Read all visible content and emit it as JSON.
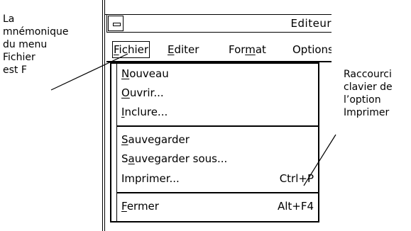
{
  "callouts": {
    "left": "La\nmnémonique\ndu menu\nFichier\nest F",
    "right": "Raccourci\nclavier de\nl’option\nImprimer"
  },
  "window": {
    "title": "Editeur"
  },
  "menubar": [
    {
      "pre": "",
      "mnemonic": "F",
      "post": "ichier"
    },
    {
      "pre": "",
      "mnemonic": "E",
      "post": "diter"
    },
    {
      "pre": "For",
      "mnemonic": "m",
      "post": "at"
    },
    {
      "pre": "Op",
      "mnemonic": "",
      "post": "tions"
    }
  ],
  "menu": {
    "groups": [
      [
        {
          "pre": "",
          "mnemonic": "N",
          "post": "ouveau",
          "accel": ""
        },
        {
          "pre": "",
          "mnemonic": "O",
          "post": "uvrir...",
          "accel": ""
        },
        {
          "pre": "",
          "mnemonic": "I",
          "post": "nclure...",
          "accel": ""
        }
      ],
      [
        {
          "pre": "",
          "mnemonic": "S",
          "post": "auvegarder",
          "accel": ""
        },
        {
          "pre": "S",
          "mnemonic": "a",
          "post": "uvegarder sous...",
          "accel": ""
        },
        {
          "pre": "",
          "mnemonic": "",
          "post": "Imprimer...",
          "accel": "Ctrl+P"
        }
      ],
      [
        {
          "pre": "",
          "mnemonic": "F",
          "post": "ermer",
          "accel": "Alt+F4"
        }
      ]
    ]
  }
}
